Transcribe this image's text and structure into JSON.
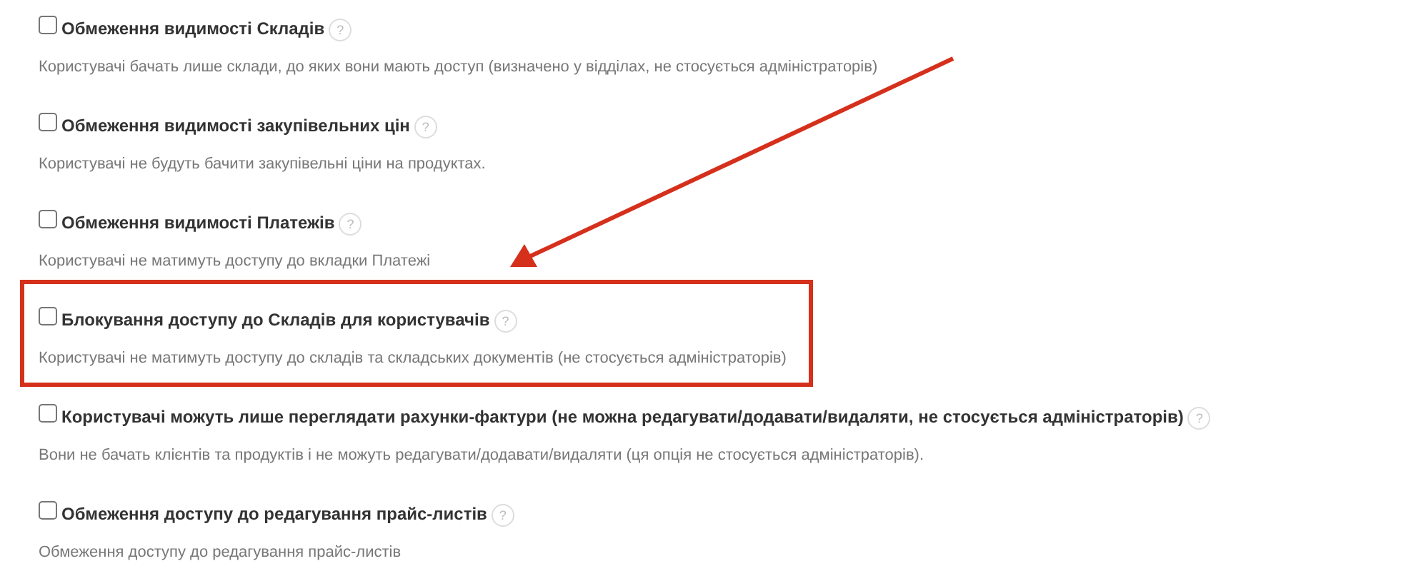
{
  "settings": [
    {
      "label": "Обмеження видимості Складів",
      "help": "?",
      "checked": false,
      "highlighted": false,
      "description": "Користувачі бачать лише склади, до яких вони мають доступ (визначено у відділах, не стосується адміністраторів)"
    },
    {
      "label": "Обмеження видимості закупівельних цін",
      "help": "?",
      "checked": false,
      "highlighted": false,
      "description": "Користувачі не будуть бачити закупівельні ціни на продуктах."
    },
    {
      "label": "Обмеження видимості Платежів",
      "help": "?",
      "checked": false,
      "highlighted": false,
      "description": "Користувачі не матимуть доступу до вкладки Платежі"
    },
    {
      "label": "Блокування доступу до Складів для користувачів",
      "help": "?",
      "checked": false,
      "highlighted": true,
      "description": "Користувачі не матимуть доступу до складів та складських документів (не стосується адміністраторів)"
    },
    {
      "label": "Користувачі можуть лише переглядати рахунки-фактури (не можна редагувати/додавати/видаляти, не стосується адміністраторів)",
      "help": "?",
      "checked": false,
      "highlighted": false,
      "description": "Вони не бачать клієнтів та продуктів і не можуть редагувати/додавати/видаляти (ця опція не стосується адміністраторів)."
    },
    {
      "label": "Обмеження доступу до редагування прайс-листів",
      "help": "?",
      "checked": false,
      "highlighted": false,
      "description": "Обмеження доступу до редагування прайс-листів"
    }
  ]
}
